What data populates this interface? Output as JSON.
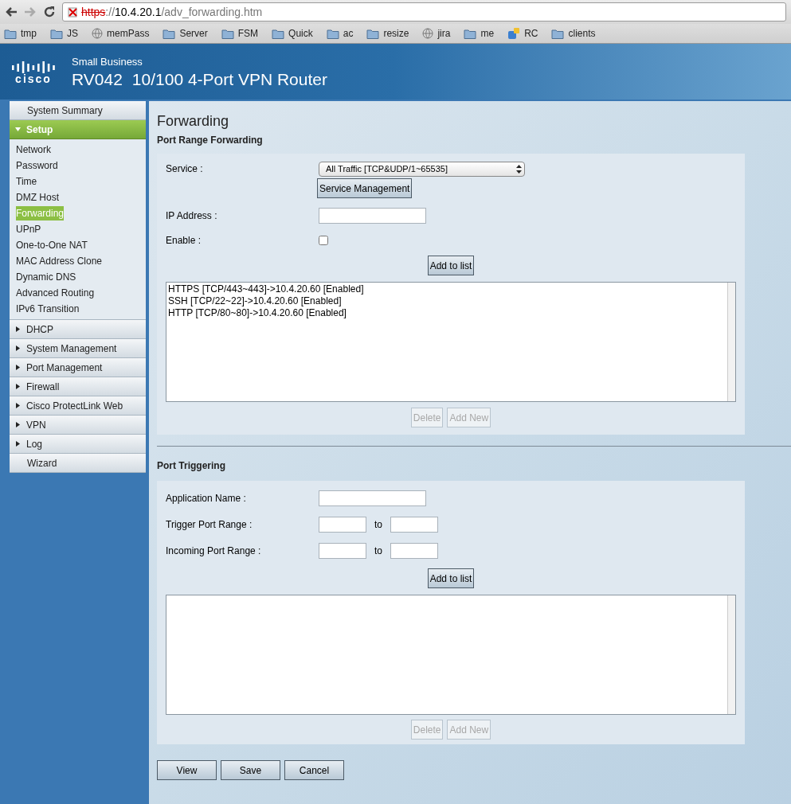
{
  "browser": {
    "url": {
      "scheme": "https",
      "separator": "://",
      "host": "10.4.20.1",
      "path": "/adv_forwarding.htm"
    },
    "insecure": true,
    "bookmarks": [
      {
        "label": "tmp",
        "kind": "folder"
      },
      {
        "label": "JS",
        "kind": "folder"
      },
      {
        "label": "memPass",
        "kind": "globe"
      },
      {
        "label": "Server",
        "kind": "folder"
      },
      {
        "label": "FSM",
        "kind": "folder"
      },
      {
        "label": "Quick",
        "kind": "folder"
      },
      {
        "label": "ac",
        "kind": "folder"
      },
      {
        "label": "resize",
        "kind": "folder"
      },
      {
        "label": "jira",
        "kind": "globe"
      },
      {
        "label": "me",
        "kind": "folder"
      },
      {
        "label": "RC",
        "kind": "app"
      },
      {
        "label": "clients",
        "kind": "folder"
      }
    ]
  },
  "header": {
    "logo": "cisco",
    "brand": "Small Business",
    "model": "RV042",
    "product": "10/100 4-Port VPN Router"
  },
  "sidebar": [
    {
      "label": "System Summary",
      "kind": "link"
    },
    {
      "label": "Setup",
      "kind": "section",
      "expanded": true,
      "children": [
        {
          "label": "Network",
          "selected": false
        },
        {
          "label": "Password",
          "selected": false
        },
        {
          "label": "Time",
          "selected": false
        },
        {
          "label": "DMZ Host",
          "selected": false
        },
        {
          "label": "Forwarding",
          "selected": true
        },
        {
          "label": "UPnP",
          "selected": false
        },
        {
          "label": "One-to-One NAT",
          "selected": false
        },
        {
          "label": "MAC Address Clone",
          "selected": false
        },
        {
          "label": "Dynamic DNS",
          "selected": false
        },
        {
          "label": "Advanced Routing",
          "selected": false
        },
        {
          "label": "IPv6 Transition",
          "selected": false
        }
      ]
    },
    {
      "label": "DHCP",
      "kind": "section",
      "expanded": false
    },
    {
      "label": "System Management",
      "kind": "section",
      "expanded": false
    },
    {
      "label": "Port Management",
      "kind": "section",
      "expanded": false
    },
    {
      "label": "Firewall",
      "kind": "section",
      "expanded": false
    },
    {
      "label": "Cisco ProtectLink Web",
      "kind": "section",
      "expanded": false
    },
    {
      "label": "VPN",
      "kind": "section",
      "expanded": false
    },
    {
      "label": "Log",
      "kind": "section",
      "expanded": false
    },
    {
      "label": "Wizard",
      "kind": "link"
    }
  ],
  "page_title": "Forwarding",
  "port_range": {
    "title": "Port Range Forwarding",
    "service_label": "Service :",
    "service_value": "All Traffic [TCP&UDP/1~65535]",
    "service_button": "Service Management",
    "ip_label": "IP Address :",
    "enable_label": "Enable :",
    "enable_checked": false,
    "add_button": "Add to list",
    "entries": [
      "HTTPS [TCP/443~443]->10.4.20.60 [Enabled]",
      "SSH [TCP/22~22]->10.4.20.60 [Enabled]",
      "HTTP [TCP/80~80]->10.4.20.60 [Enabled]"
    ],
    "actions": [
      {
        "label": "Delete",
        "disabled": true
      },
      {
        "label": "Add New",
        "disabled": true
      }
    ]
  },
  "port_triggering": {
    "title": "Port Triggering",
    "app_label": "Application Name :",
    "trigger_label": "Trigger Port Range :",
    "incoming_label": "Incoming Port Range :",
    "trigger_to": "to",
    "incoming_to": "to",
    "add_button": "Add to list",
    "actions": [
      {
        "label": "Delete",
        "disabled": true
      },
      {
        "label": "Add New",
        "disabled": true
      }
    ]
  },
  "footer_buttons": [
    "View",
    "Save",
    "Cancel"
  ]
}
